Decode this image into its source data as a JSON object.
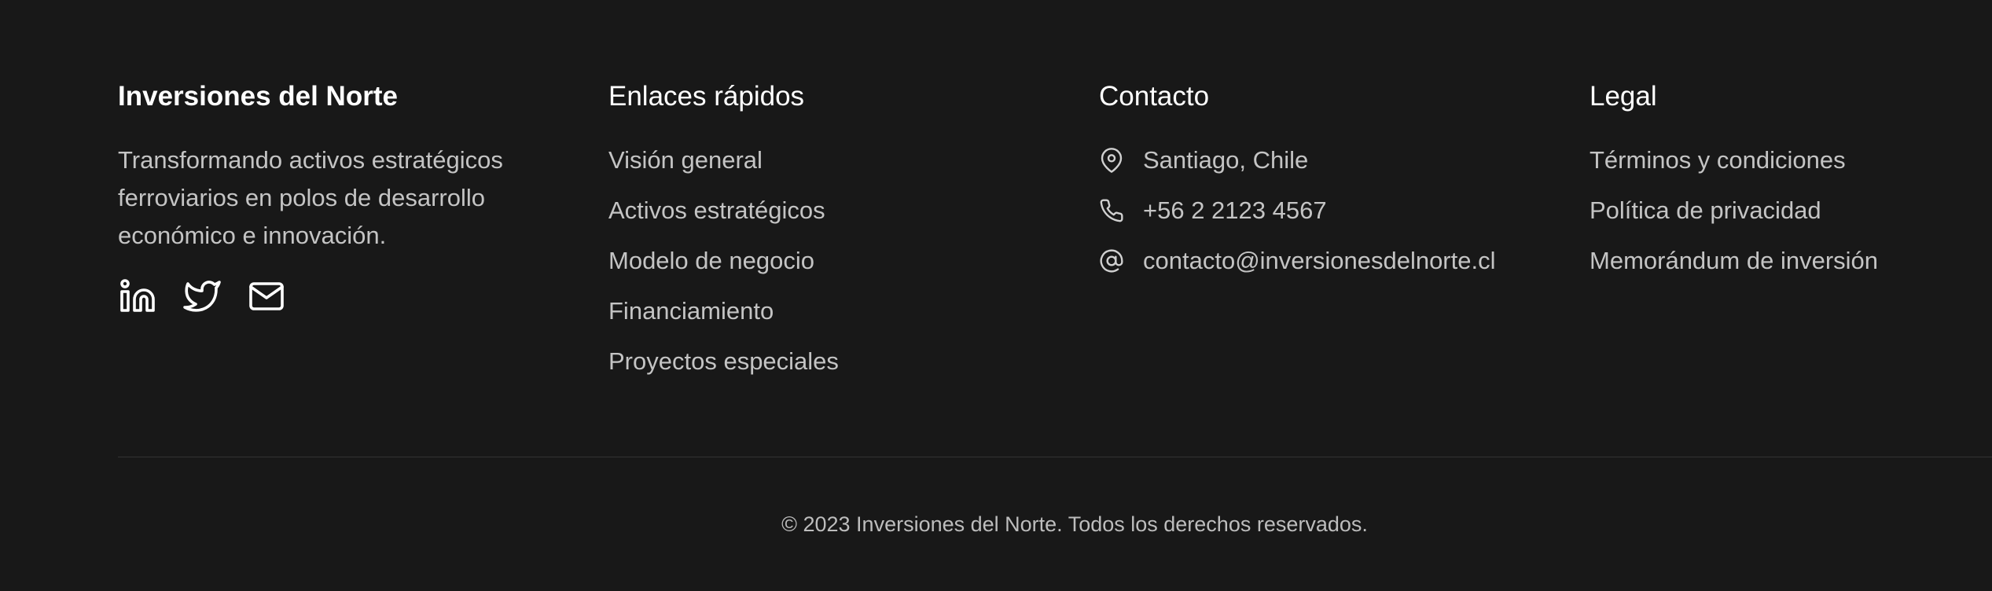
{
  "brand": {
    "name": "Inversiones del Norte",
    "tagline": "Transformando activos estratégicos ferroviarios en polos de desarrollo económico e innovación.",
    "socials": [
      {
        "icon": "linkedin-icon"
      },
      {
        "icon": "twitter-icon"
      },
      {
        "icon": "mail-icon"
      }
    ]
  },
  "quick_links": {
    "title": "Enlaces rápidos",
    "items": [
      {
        "label": "Visión general"
      },
      {
        "label": "Activos estratégicos"
      },
      {
        "label": "Modelo de negocio"
      },
      {
        "label": "Financiamiento"
      },
      {
        "label": "Proyectos especiales"
      }
    ]
  },
  "contact": {
    "title": "Contacto",
    "items": [
      {
        "icon": "map-pin-icon",
        "label": "Santiago, Chile"
      },
      {
        "icon": "phone-icon",
        "label": "+56 2 2123 4567"
      },
      {
        "icon": "at-sign-icon",
        "label": "contacto@inversionesdelnorte.cl"
      }
    ]
  },
  "legal": {
    "title": "Legal",
    "items": [
      {
        "label": "Términos y condiciones"
      },
      {
        "label": "Política de privacidad"
      },
      {
        "label": "Memorándum de inversión"
      }
    ]
  },
  "footer": {
    "copyright": "© 2023 Inversiones del Norte. Todos los derechos reservados."
  },
  "colors": {
    "background": "#181818",
    "heading": "#ffffff",
    "text": "#c4c4c4",
    "divider": "#333333"
  }
}
